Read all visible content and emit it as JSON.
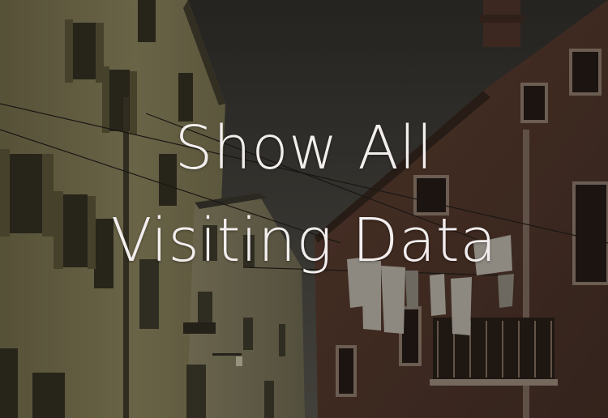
{
  "banner": {
    "line1": "Show All",
    "line2": "Visiting Data"
  },
  "background": {
    "subject": "venice-alley-laundry-photo"
  },
  "colors": {
    "text": "#f3eeee",
    "sky": "#3a3935",
    "left_facade": "#807a55",
    "right_facade": "#5a3a2c",
    "laundry": "#b9b6ad"
  }
}
